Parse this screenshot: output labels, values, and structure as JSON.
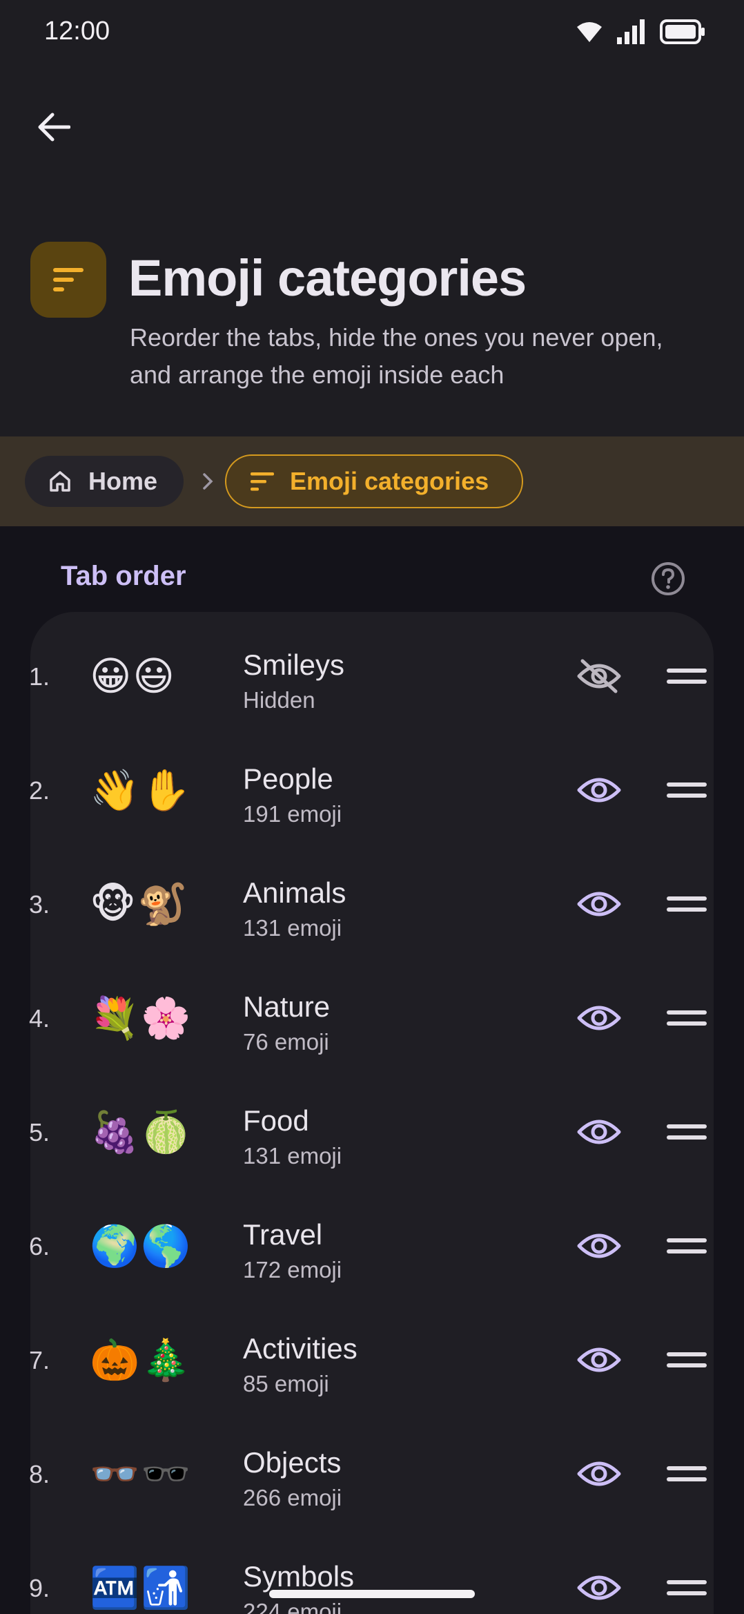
{
  "status_bar": {
    "time": "12:00"
  },
  "header": {
    "title": "Emoji categories",
    "subtitle": "Reorder the tabs, hide the ones you never open, and arrange the emoji inside each"
  },
  "breadcrumb": {
    "home_label": "Home",
    "current_label": "Emoji categories"
  },
  "section": {
    "label": "Tab order"
  },
  "colors": {
    "accent": "#f3b02c",
    "purple": "#cdbff6",
    "background": "#14131a"
  },
  "categories": [
    {
      "index": "1.",
      "emoji": "😀😃",
      "name": "Smileys",
      "count": "Hidden",
      "visible": false
    },
    {
      "index": "2.",
      "emoji": "👋✋",
      "name": "People",
      "count": "191 emoji",
      "visible": true
    },
    {
      "index": "3.",
      "emoji": "🐵🐒",
      "name": "Animals",
      "count": "131 emoji",
      "visible": true
    },
    {
      "index": "4.",
      "emoji": "💐🌸",
      "name": "Nature",
      "count": "76 emoji",
      "visible": true
    },
    {
      "index": "5.",
      "emoji": "🍇🍈",
      "name": "Food",
      "count": "131 emoji",
      "visible": true
    },
    {
      "index": "6.",
      "emoji": "🌍🌎",
      "name": "Travel",
      "count": "172 emoji",
      "visible": true
    },
    {
      "index": "7.",
      "emoji": "🎃🎄",
      "name": "Activities",
      "count": "85 emoji",
      "visible": true
    },
    {
      "index": "8.",
      "emoji": "👓🕶️",
      "name": "Objects",
      "count": "266 emoji",
      "visible": true
    },
    {
      "index": "9.",
      "emoji": "🏧🚮",
      "name": "Symbols",
      "count": "224 emoji",
      "visible": true
    }
  ]
}
